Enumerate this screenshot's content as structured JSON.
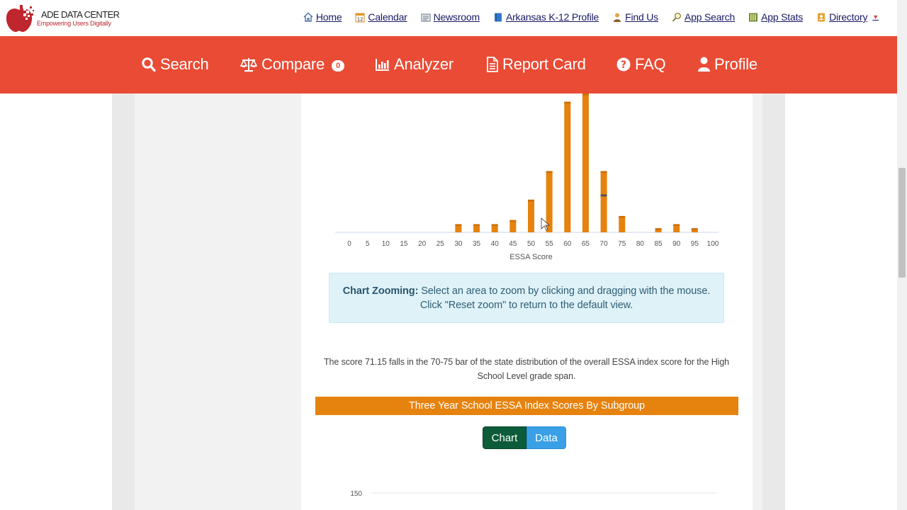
{
  "logo": {
    "title": "ADE DATA CENTER",
    "tagline": "Empowering Users Digitally"
  },
  "top_nav": [
    {
      "label": "Home",
      "icon": "home-icon",
      "name": "home"
    },
    {
      "label": "Calendar",
      "icon": "calendar-icon",
      "name": "calendar"
    },
    {
      "label": "Newsroom",
      "icon": "newspaper-icon",
      "name": "newsroom"
    },
    {
      "label": "Arkansas K-12 Profile",
      "icon": "book-icon",
      "name": "k12-profile"
    },
    {
      "label": "Find Us",
      "icon": "person-icon",
      "name": "find-us"
    },
    {
      "label": "App Search",
      "icon": "magnifier-icon",
      "name": "app-search"
    },
    {
      "label": "App Stats",
      "icon": "stats-icon",
      "name": "app-stats"
    },
    {
      "label": "Directory",
      "icon": "address-book-icon",
      "name": "directory"
    }
  ],
  "main_nav": {
    "search": "Search",
    "compare": "Compare",
    "compare_count": "0",
    "analyzer": "Analyzer",
    "report_card": "Report Card",
    "faq": "FAQ",
    "profile": "Profile"
  },
  "colors": {
    "nav_red": "#e94b35",
    "bar_orange": "#e6820e",
    "chart_toggle_active": "#0c5c3a",
    "data_toggle": "#3aa0e6",
    "highlight_bar_mark": "#555555"
  },
  "chart_data": [
    {
      "type": "bar",
      "xlabel": "ESSA Score",
      "x_ticks": [
        "0",
        "5",
        "10",
        "15",
        "20",
        "25",
        "30",
        "35",
        "40",
        "45",
        "50",
        "55",
        "60",
        "65",
        "70",
        "75",
        "80",
        "85",
        "90",
        "95",
        "100"
      ],
      "categories": [
        30,
        35,
        40,
        45,
        50,
        55,
        60,
        65,
        70,
        75,
        85,
        90,
        95
      ],
      "values": [
        2,
        2,
        2,
        3,
        8,
        15,
        32,
        34,
        15,
        4,
        1,
        2,
        1
      ],
      "highlight": {
        "bin": "70-75",
        "score": 71.15
      },
      "grid": false,
      "legend": "none"
    },
    {
      "type": "bar",
      "y_ticks": [
        "150"
      ],
      "grid": true
    }
  ],
  "zoom_note": {
    "label": "Chart Zooming:",
    "text": " Select an area to zoom by clicking and dragging with the mouse. Click \"Reset zoom\" to return to the default view."
  },
  "score_sentence": "The score 71.15 falls in the 70-75 bar of the state distribution of the overall ESSA index score for the High School Level grade span.",
  "section_header": "Three Year School ESSA Index Scores By Subgroup",
  "view_toggle": {
    "chart": "Chart",
    "data": "Data"
  }
}
